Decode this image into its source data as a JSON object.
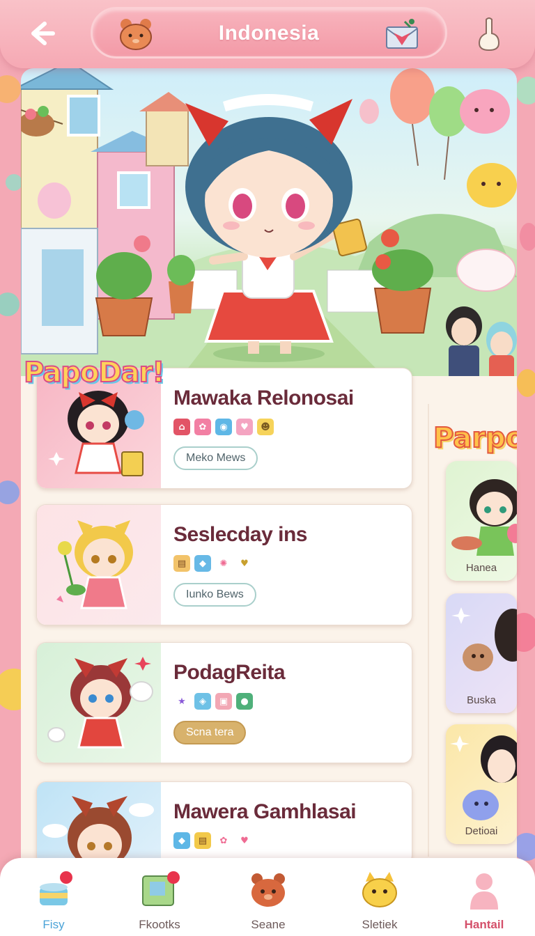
{
  "header": {
    "title": "Indonesia"
  },
  "hero": {
    "badge": "PapoDar!",
    "side_badge": "Parpo"
  },
  "cards": [
    {
      "title": "Mawaka Relonosai",
      "tag": "Meko Mews"
    },
    {
      "title": "Seslecday ins",
      "tag": "Iunko Bews"
    },
    {
      "title": "PodagReita",
      "tag": "Scna tera"
    },
    {
      "title": "Mawera Gamhlasai",
      "tag": ""
    }
  ],
  "side_cards": [
    {
      "label": "Hanea"
    },
    {
      "label": "Buska"
    },
    {
      "label": "Detioai"
    }
  ],
  "nav": {
    "items": [
      {
        "label": "Fisy"
      },
      {
        "label": "Fkootks"
      },
      {
        "label": "Seane"
      },
      {
        "label": "Sletiek"
      },
      {
        "label": "Hantail"
      }
    ]
  },
  "colors": {
    "frame": "#f4a9b5",
    "header": "#f6a9b4",
    "title_text": "#6a2b3a",
    "nav_active": "#4aa3d8",
    "nav_highlight": "#d4506a"
  }
}
